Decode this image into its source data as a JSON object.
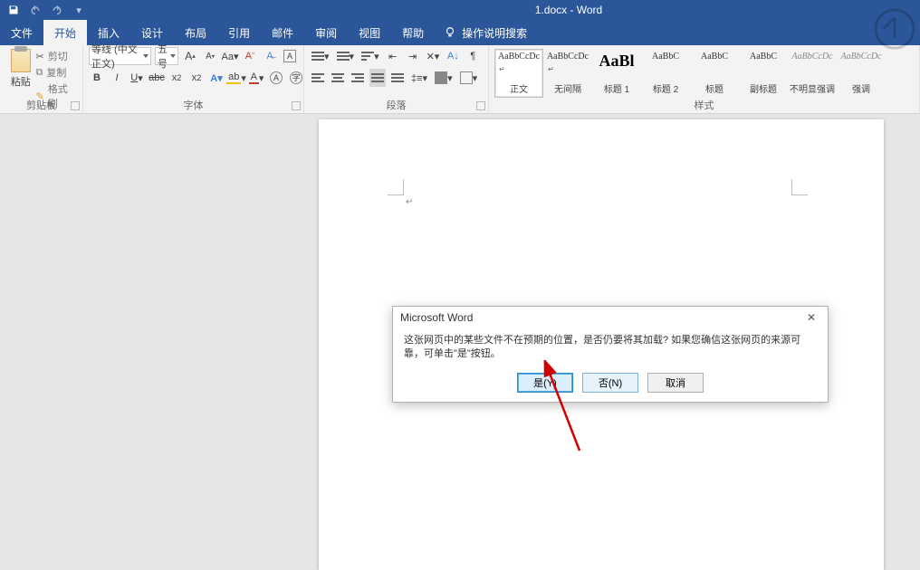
{
  "titlebar": {
    "doc_title": "1.docx  -  Word"
  },
  "tabs": {
    "file": "文件",
    "home": "开始",
    "insert": "插入",
    "design": "设计",
    "layout": "布局",
    "references": "引用",
    "mail": "邮件",
    "review": "审阅",
    "view": "视图",
    "help": "帮助",
    "tell_me": "操作说明搜索"
  },
  "ribbon": {
    "clipboard": {
      "paste": "粘贴",
      "cut": "剪切",
      "copy": "复制",
      "format_painter": "格式刷",
      "label": "剪贴板"
    },
    "font": {
      "name": "等线 (中文正文)",
      "size": "五号",
      "label": "字体"
    },
    "paragraph": {
      "label": "段落"
    },
    "styles": {
      "label": "样式",
      "items": [
        {
          "preview": "AaBbCcDc",
          "name": "正文",
          "marker": "↵"
        },
        {
          "preview": "AaBbCcDc",
          "name": "无间隔",
          "marker": "↵"
        },
        {
          "preview": "AaBl",
          "name": "标题 1",
          "big": true
        },
        {
          "preview": "AaBbC",
          "name": "标题 2"
        },
        {
          "preview": "AaBbC",
          "name": "标题"
        },
        {
          "preview": "AaBbC",
          "name": "副标题"
        },
        {
          "preview": "AaBbCcDc",
          "name": "不明显强调",
          "italic": true
        },
        {
          "preview": "AaBbCcDc",
          "name": "强调",
          "italic": true
        }
      ]
    }
  },
  "dialog": {
    "title": "Microsoft Word",
    "message": "这张网页中的某些文件不在预期的位置，是否仍要将其加载? 如果您确信这张网页的来源可靠，可单击\"是\"按钮。",
    "yes": "是(Y)",
    "no": "否(N)",
    "cancel": "取消"
  }
}
